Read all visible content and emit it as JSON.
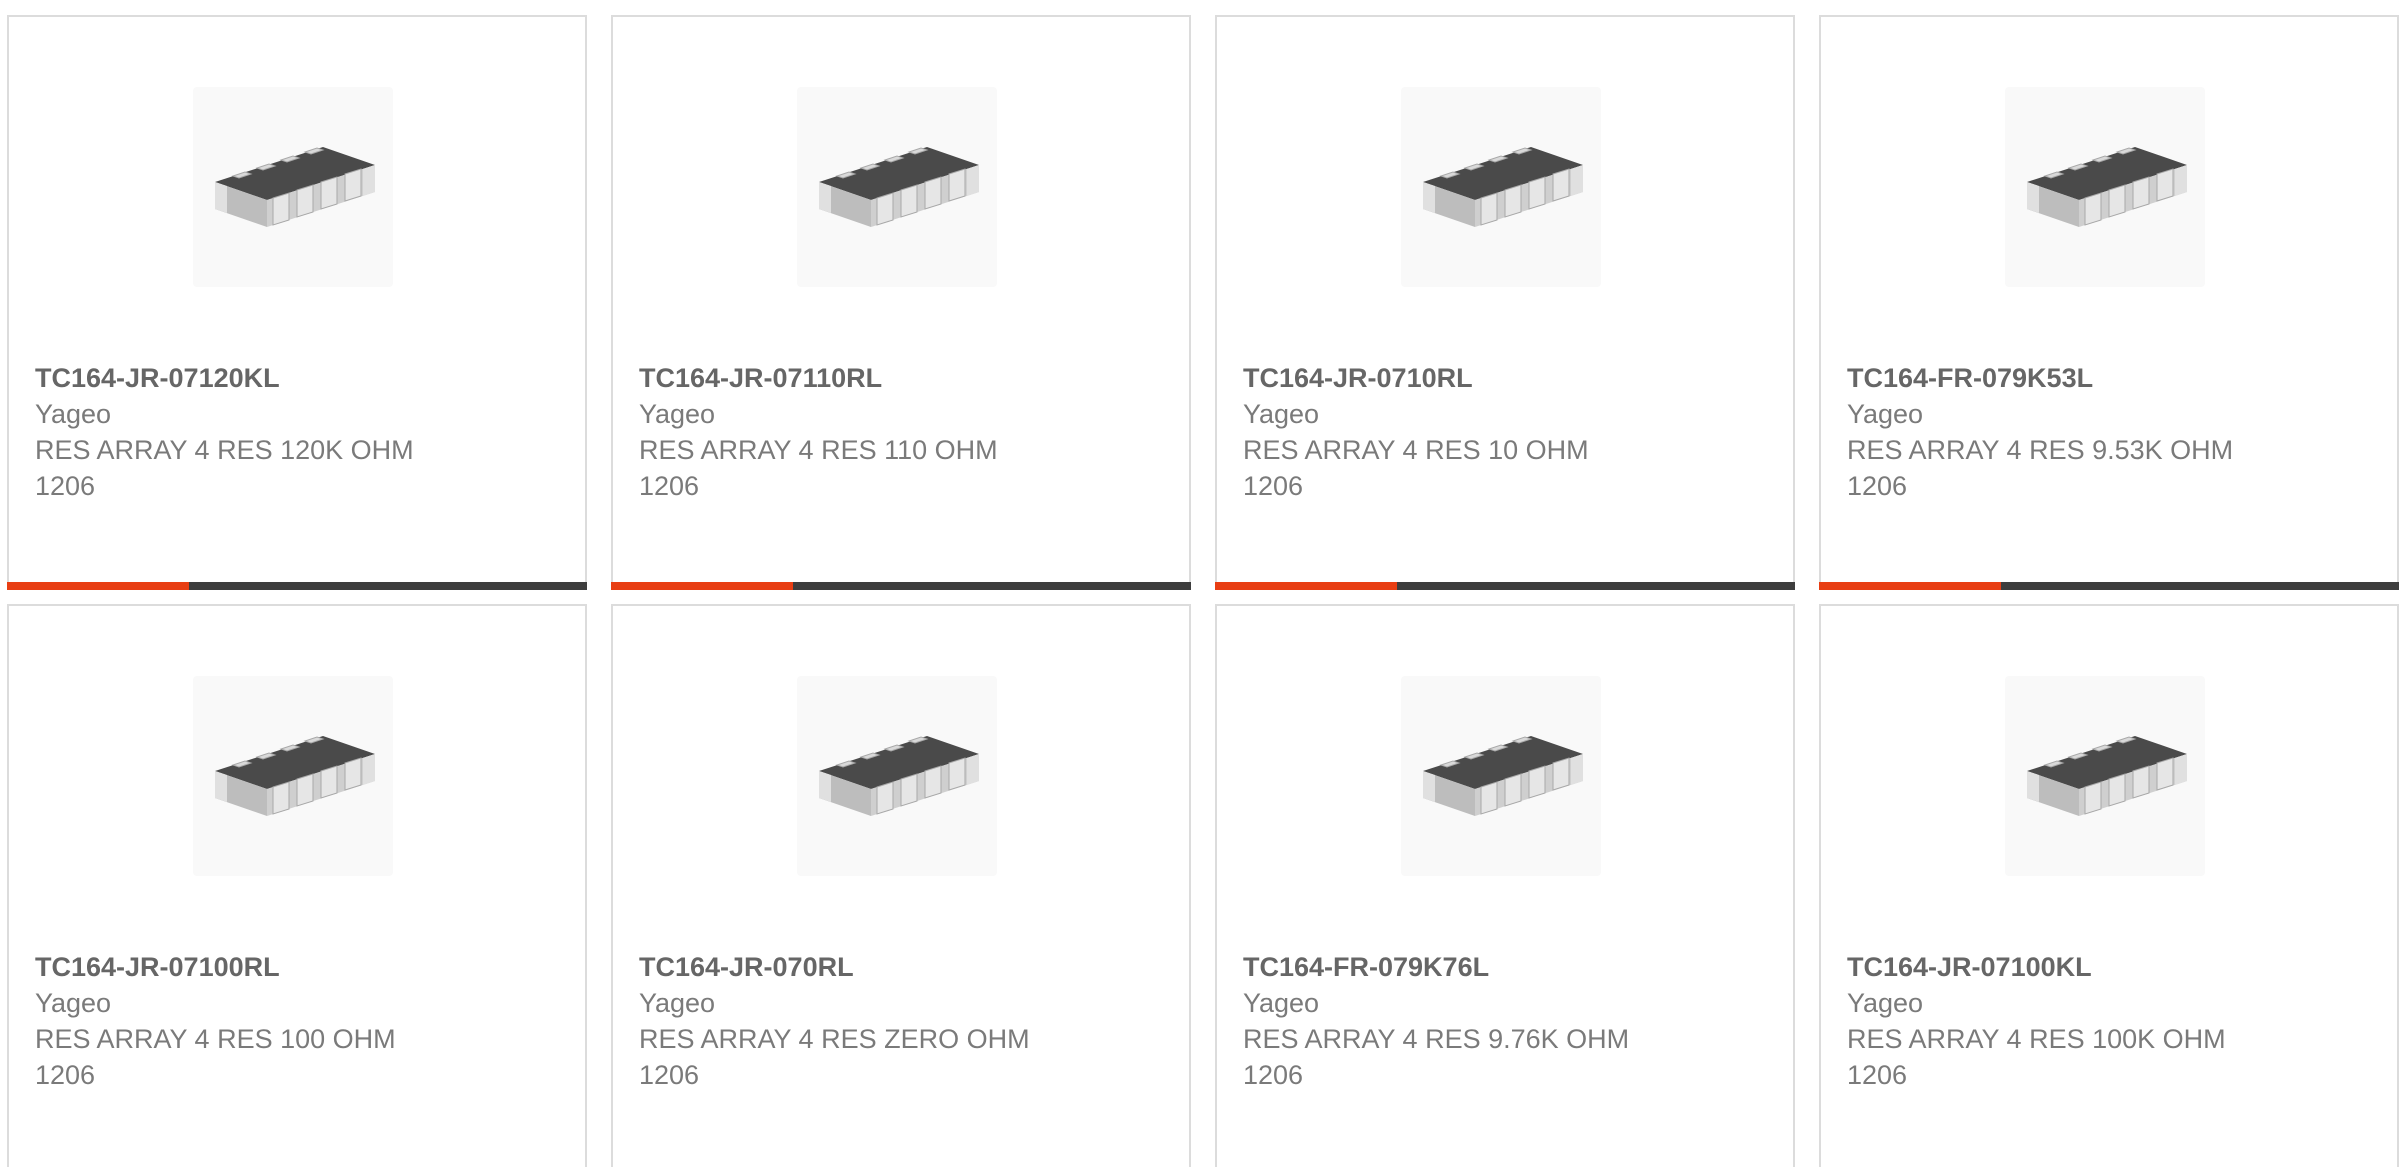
{
  "colors": {
    "accent": "#e83e13",
    "bar": "#3d3d3d",
    "border": "#dcdcdc",
    "part_number": "#666666",
    "text": "#7a7a7a"
  },
  "products": [
    {
      "part_number": "TC164-JR-07120KL",
      "manufacturer": "Yageo",
      "description": "RES ARRAY 4 RES 120K OHM",
      "package": "1206",
      "image_icon": "resistor-array-chip-icon"
    },
    {
      "part_number": "TC164-JR-07110RL",
      "manufacturer": "Yageo",
      "description": "RES ARRAY 4 RES 110 OHM",
      "package": "1206",
      "image_icon": "resistor-array-chip-icon"
    },
    {
      "part_number": "TC164-JR-0710RL",
      "manufacturer": "Yageo",
      "description": "RES ARRAY 4 RES 10 OHM",
      "package": "1206",
      "image_icon": "resistor-array-chip-icon"
    },
    {
      "part_number": "TC164-FR-079K53L",
      "manufacturer": "Yageo",
      "description": "RES ARRAY 4 RES 9.53K OHM",
      "package": "1206",
      "image_icon": "resistor-array-chip-icon"
    },
    {
      "part_number": "TC164-JR-07100RL",
      "manufacturer": "Yageo",
      "description": "RES ARRAY 4 RES 100 OHM",
      "package": "1206",
      "image_icon": "resistor-array-chip-icon"
    },
    {
      "part_number": "TC164-JR-070RL",
      "manufacturer": "Yageo",
      "description": "RES ARRAY 4 RES ZERO OHM",
      "package": "1206",
      "image_icon": "resistor-array-chip-icon"
    },
    {
      "part_number": "TC164-FR-079K76L",
      "manufacturer": "Yageo",
      "description": "RES ARRAY 4 RES 9.76K OHM",
      "package": "1206",
      "image_icon": "resistor-array-chip-icon"
    },
    {
      "part_number": "TC164-JR-07100KL",
      "manufacturer": "Yageo",
      "description": "RES ARRAY 4 RES 100K OHM",
      "package": "1206",
      "image_icon": "resistor-array-chip-icon"
    }
  ]
}
